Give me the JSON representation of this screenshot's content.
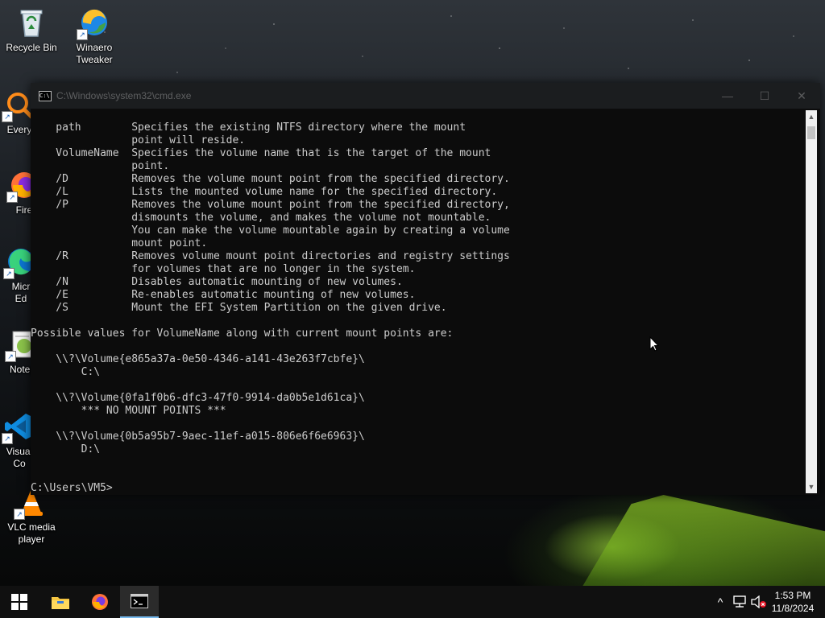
{
  "desktop": {
    "icons": [
      {
        "label": "Recycle Bin",
        "icon": "recycle-bin-icon"
      },
      {
        "label": "Winaero\nTweaker",
        "icon": "winaero-tweaker-icon"
      },
      {
        "label": "Every",
        "icon": "everything-icon"
      },
      {
        "label": "Fire",
        "icon": "firefox-icon"
      },
      {
        "label": "Micr\nEd",
        "icon": "edge-icon"
      },
      {
        "label": "Notep",
        "icon": "notepad-icon"
      },
      {
        "label": "Visual\nCo",
        "icon": "vscode-icon"
      },
      {
        "label": "VLC media\nplayer",
        "icon": "vlc-icon"
      }
    ]
  },
  "console": {
    "title": "C:\\Windows\\system32\\cmd.exe",
    "buttons": {
      "minimize": "—",
      "maximize": "☐",
      "close": "✕"
    },
    "lines": [
      "    path        Specifies the existing NTFS directory where the mount",
      "                point will reside.",
      "    VolumeName  Specifies the volume name that is the target of the mount",
      "                point.",
      "    /D          Removes the volume mount point from the specified directory.",
      "    /L          Lists the mounted volume name for the specified directory.",
      "    /P          Removes the volume mount point from the specified directory,",
      "                dismounts the volume, and makes the volume not mountable.",
      "                You can make the volume mountable again by creating a volume",
      "                mount point.",
      "    /R          Removes volume mount point directories and registry settings",
      "                for volumes that are no longer in the system.",
      "    /N          Disables automatic mounting of new volumes.",
      "    /E          Re-enables automatic mounting of new volumes.",
      "    /S          Mount the EFI System Partition on the given drive.",
      "",
      "Possible values for VolumeName along with current mount points are:",
      "",
      "    \\\\?\\Volume{e865a37a-0e50-4346-a141-43e263f7cbfe}\\",
      "        C:\\",
      "",
      "    \\\\?\\Volume{0fa1f0b6-dfc3-47f0-9914-da0b5e1d61ca}\\",
      "        *** NO MOUNT POINTS ***",
      "",
      "    \\\\?\\Volume{0b5a95b7-9aec-11ef-a015-806e6f6e6963}\\",
      "        D:\\",
      "",
      "",
      "C:\\Users\\VM5>"
    ],
    "scrollbar": {
      "up": "▲",
      "down": "▼"
    }
  },
  "taskbar": {
    "start": "start-icon",
    "pinned": [
      "file-explorer-icon",
      "firefox-icon",
      "command-prompt-icon"
    ],
    "tray": {
      "chevron": "^",
      "network": "network-icon",
      "volume": "volume-muted-icon"
    },
    "time": "1:53 PM",
    "date": "11/8/2024"
  }
}
